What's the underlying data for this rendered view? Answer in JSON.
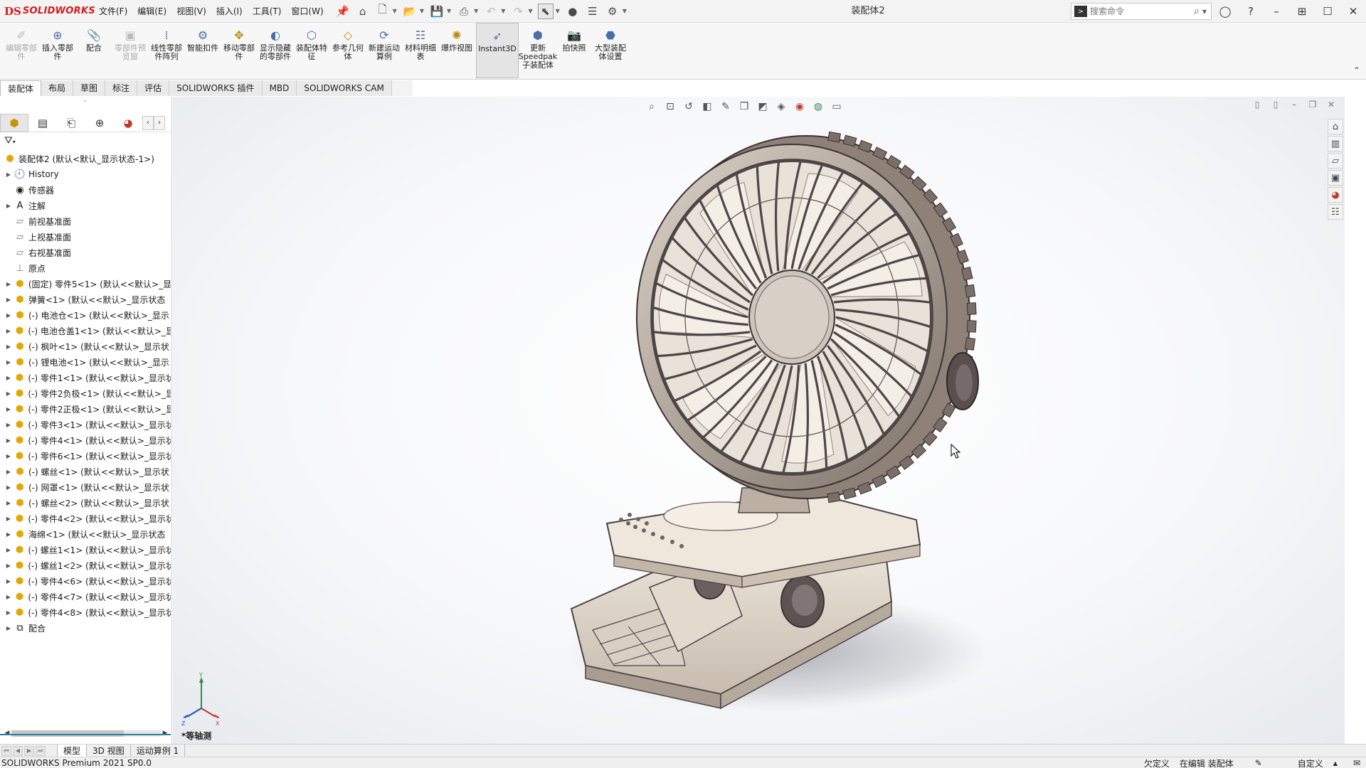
{
  "app": {
    "logo_ds": "DS",
    "logo_text": "SOLIDWORKS",
    "doc_title": "装配体2"
  },
  "menu": [
    "文件(F)",
    "编辑(E)",
    "视图(V)",
    "插入(I)",
    "工具(T)",
    "窗口(W)"
  ],
  "search": {
    "placeholder": "搜索命令"
  },
  "ribbon": [
    {
      "label": "编辑零部件",
      "icon": "edit-component-icon",
      "disabled": true
    },
    {
      "label": "插入零部件",
      "icon": "insert-components-icon",
      "disabled": false
    },
    {
      "label": "配合",
      "icon": "mate-icon",
      "disabled": false
    },
    {
      "label": "零部件预览窗",
      "icon": "component-preview-icon",
      "disabled": true
    },
    {
      "label": "线性零部件阵列",
      "icon": "linear-pattern-icon",
      "disabled": false
    },
    {
      "label": "智能扣件",
      "icon": "smart-fasteners-icon",
      "disabled": false
    },
    {
      "label": "移动零部件",
      "icon": "move-component-icon",
      "disabled": false
    },
    {
      "label": "显示隐藏的零部件",
      "icon": "show-hidden-icon",
      "disabled": false
    },
    {
      "label": "装配体特征",
      "icon": "assembly-features-icon",
      "disabled": false
    },
    {
      "label": "参考几何体",
      "icon": "reference-geometry-icon",
      "disabled": false
    },
    {
      "label": "新建运动算例",
      "icon": "motion-study-icon",
      "disabled": false
    },
    {
      "label": "材料明细表",
      "icon": "bom-icon",
      "disabled": false
    },
    {
      "label": "爆炸视图",
      "icon": "exploded-view-icon",
      "disabled": false
    },
    {
      "label": "Instant3D",
      "icon": "instant3d-icon",
      "disabled": false,
      "active": true
    },
    {
      "label": "更新Speedpak子装配体",
      "icon": "speedpak-icon",
      "disabled": false
    },
    {
      "label": "拍快照",
      "icon": "snapshot-icon",
      "disabled": false
    },
    {
      "label": "大型装配体设置",
      "icon": "large-assembly-icon",
      "disabled": false
    }
  ],
  "command_tabs": [
    "装配体",
    "布局",
    "草图",
    "标注",
    "评估",
    "SOLIDWORKS 插件",
    "MBD",
    "SOLIDWORKS CAM"
  ],
  "tree": {
    "root": "装配体2 (默认<默认_显示状态-1>)",
    "items": [
      {
        "label": "History",
        "icon": "history-icon",
        "expand": true,
        "type": "folder"
      },
      {
        "label": "传感器",
        "icon": "sensor-icon",
        "expand": false,
        "type": "folder"
      },
      {
        "label": "注解",
        "icon": "annotation-icon",
        "expand": true,
        "type": "folder"
      },
      {
        "label": "前视基准面",
        "icon": "plane-icon",
        "expand": false,
        "type": "plane"
      },
      {
        "label": "上视基准面",
        "icon": "plane-icon",
        "expand": false,
        "type": "plane"
      },
      {
        "label": "右视基准面",
        "icon": "plane-icon",
        "expand": false,
        "type": "plane"
      },
      {
        "label": "原点",
        "icon": "origin-icon",
        "expand": false,
        "type": "plane"
      },
      {
        "label": "(固定) 零件5<1> (默认<<默认>_显",
        "icon": "part-icon",
        "expand": true,
        "type": "part"
      },
      {
        "label": "弹簧<1> (默认<<默认>_显示状态",
        "icon": "part-icon",
        "expand": true,
        "type": "part"
      },
      {
        "label": "(-) 电池仓<1> (默认<<默认>_显示",
        "icon": "part-icon",
        "expand": true,
        "type": "part"
      },
      {
        "label": "(-) 电池仓盖1<1> (默认<<默认>_显",
        "icon": "part-icon",
        "expand": true,
        "type": "part"
      },
      {
        "label": "(-) 枫叶<1> (默认<<默认>_显示状",
        "icon": "part-icon",
        "expand": true,
        "type": "part"
      },
      {
        "label": "(-) 锂电池<1> (默认<<默认>_显示",
        "icon": "part-icon",
        "expand": true,
        "type": "part"
      },
      {
        "label": "(-) 零件1<1> (默认<<默认>_显示状",
        "icon": "part-icon",
        "expand": true,
        "type": "part"
      },
      {
        "label": "(-) 零件2负极<1> (默认<<默认>_显",
        "icon": "part-icon",
        "expand": true,
        "type": "part"
      },
      {
        "label": "(-) 零件2正极<1> (默认<<默认>_显",
        "icon": "part-icon",
        "expand": true,
        "type": "part"
      },
      {
        "label": "(-) 零件3<1> (默认<<默认>_显示状",
        "icon": "part-icon",
        "expand": true,
        "type": "part"
      },
      {
        "label": "(-) 零件4<1> (默认<<默认>_显示状",
        "icon": "part-icon",
        "expand": true,
        "type": "part"
      },
      {
        "label": "(-) 零件6<1> (默认<<默认>_显示状",
        "icon": "part-icon",
        "expand": true,
        "type": "part"
      },
      {
        "label": "(-) 螺丝<1> (默认<<默认>_显示状",
        "icon": "part-icon",
        "expand": true,
        "type": "part"
      },
      {
        "label": "(-) 网罩<1> (默认<<默认>_显示状",
        "icon": "part-icon",
        "expand": true,
        "type": "part"
      },
      {
        "label": "(-) 螺丝<2> (默认<<默认>_显示状",
        "icon": "part-icon",
        "expand": true,
        "type": "part"
      },
      {
        "label": "(-) 零件4<2> (默认<<默认>_显示状",
        "icon": "part-icon",
        "expand": true,
        "type": "part"
      },
      {
        "label": "海绵<1> (默认<<默认>_显示状态",
        "icon": "part-icon",
        "expand": true,
        "type": "part"
      },
      {
        "label": "(-) 螺丝1<1> (默认<<默认>_显示状",
        "icon": "part-icon",
        "expand": true,
        "type": "part"
      },
      {
        "label": "(-) 螺丝1<2> (默认<<默认>_显示状",
        "icon": "part-icon",
        "expand": true,
        "type": "part"
      },
      {
        "label": "(-) 零件4<6> (默认<<默认>_显示状",
        "icon": "part-icon",
        "expand": true,
        "type": "part"
      },
      {
        "label": "(-) 零件4<7> (默认<<默认>_显示状",
        "icon": "part-icon",
        "expand": true,
        "type": "part"
      },
      {
        "label": "(-) 零件4<8> (默认<<默认>_显示状",
        "icon": "part-icon",
        "expand": true,
        "type": "part"
      },
      {
        "label": "配合",
        "icon": "mates-folder-icon",
        "expand": true,
        "type": "folder"
      }
    ]
  },
  "viewport": {
    "view_name": "*等轴测",
    "triad": {
      "x": "X",
      "y": "Y",
      "z": "Z"
    }
  },
  "bottom_tabs": [
    "模型",
    "3D 视图",
    "运动算例 1"
  ],
  "status": {
    "product": "SOLIDWORKS Premium 2021 SP0.0",
    "state": "欠定义",
    "editing": "在编辑 装配体",
    "units": "自定义"
  },
  "colors": {
    "brand_red": "#d71920",
    "part_yellow": "#e1a800",
    "accent_blue": "#2c7ea1"
  }
}
